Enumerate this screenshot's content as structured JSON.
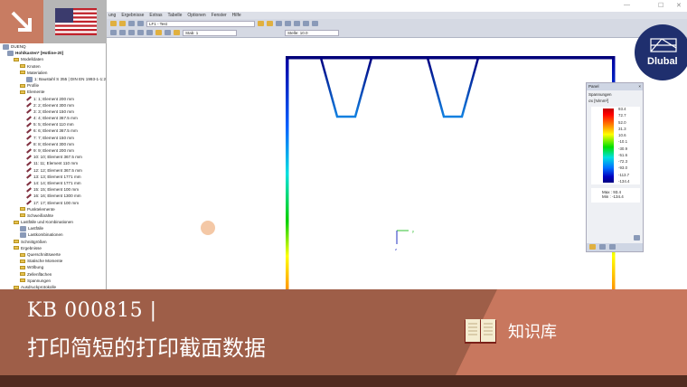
{
  "window": {
    "controls": [
      "—",
      "☐",
      "✕"
    ]
  },
  "menu": [
    "ung",
    "Ergebnisse",
    "Extras",
    "Tabelle",
    "Optionen",
    "Fenster",
    "Hilfe"
  ],
  "toolbar": {
    "loadcase": "LF1 - Test",
    "member": "Stab: 1",
    "location": "Stelle: 10.0"
  },
  "tree": {
    "root": "DUENQ",
    "project": "Hohlkasten* [Hotline-20]",
    "items": [
      {
        "label": "Modelldaten",
        "level": 1,
        "type": "folder"
      },
      {
        "label": "Knoten",
        "level": 2,
        "type": "folder"
      },
      {
        "label": "Materialien",
        "level": 2,
        "type": "folder"
      },
      {
        "label": "1: Baustahl S 355 | DIN EN 1993-1-1:2",
        "level": 3,
        "type": "material"
      },
      {
        "label": "Profile",
        "level": 2,
        "type": "folder"
      },
      {
        "label": "Elemente",
        "level": 2,
        "type": "folder"
      },
      {
        "label": "1: 1; Element 200 mm",
        "level": 3,
        "type": "element"
      },
      {
        "label": "2: 2; Element 300 mm",
        "level": 3,
        "type": "element"
      },
      {
        "label": "3: 3; Element 150 mm",
        "level": 3,
        "type": "element"
      },
      {
        "label": "4: 4; Element 367.5 mm",
        "level": 3,
        "type": "element"
      },
      {
        "label": "5: 5; Element 110 mm",
        "level": 3,
        "type": "element"
      },
      {
        "label": "6: 6; Element 367.5 mm",
        "level": 3,
        "type": "element"
      },
      {
        "label": "7: 7; Element 150 mm",
        "level": 3,
        "type": "element"
      },
      {
        "label": "8: 8; Element 300 mm",
        "level": 3,
        "type": "element"
      },
      {
        "label": "9: 9; Element 200 mm",
        "level": 3,
        "type": "element"
      },
      {
        "label": "10: 10; Element 367.5 mm",
        "level": 3,
        "type": "element"
      },
      {
        "label": "11: 11; Element 110 mm",
        "level": 3,
        "type": "element"
      },
      {
        "label": "12: 12; Element 367.5 mm",
        "level": 3,
        "type": "element"
      },
      {
        "label": "13: 13; Element 1771 mm",
        "level": 3,
        "type": "element"
      },
      {
        "label": "14: 14; Element 1771 mm",
        "level": 3,
        "type": "element"
      },
      {
        "label": "15: 15; Element 100 mm",
        "level": 3,
        "type": "element"
      },
      {
        "label": "16: 16; Element 1300 mm",
        "level": 3,
        "type": "element"
      },
      {
        "label": "17: 17; Element 100 mm",
        "level": 3,
        "type": "element"
      },
      {
        "label": "Punktelemente",
        "level": 2,
        "type": "folder"
      },
      {
        "label": "Schweißnähte",
        "level": 2,
        "type": "folder"
      },
      {
        "label": "Lastfälle und Kombinationen",
        "level": 1,
        "type": "folder"
      },
      {
        "label": "Lastfälle",
        "level": 2,
        "type": "load"
      },
      {
        "label": "Lastkombinationen",
        "level": 2,
        "type": "load"
      },
      {
        "label": "Schnittgrößen",
        "level": 1,
        "type": "folder"
      },
      {
        "label": "Ergebnisse",
        "level": 1,
        "type": "folder"
      },
      {
        "label": "Querschnittswerte",
        "level": 2,
        "type": "folder"
      },
      {
        "label": "Statische Momente",
        "level": 2,
        "type": "folder"
      },
      {
        "label": "Wölbung",
        "level": 2,
        "type": "folder"
      },
      {
        "label": "Zellenflächen",
        "level": 2,
        "type": "folder"
      },
      {
        "label": "Spannungen",
        "level": 2,
        "type": "folder"
      },
      {
        "label": "Ausdruckprotokolle",
        "level": 1,
        "type": "folder"
      }
    ]
  },
  "panel": {
    "title": "Panel",
    "close": "×",
    "heading": "Spannungen",
    "unit": "σx [N/mm²]",
    "levels": [
      "93.4",
      "72.7",
      "52.0",
      "31.3",
      "10.6",
      "-10.1",
      "-30.9",
      "-51.6",
      "-72.3",
      "-93.0",
      "-113.7",
      "-134.4"
    ],
    "max_label": "Max :",
    "max": "93.4",
    "min_label": "Min :",
    "min": "-134.4"
  },
  "axes": {
    "y": "y",
    "z": "z"
  },
  "banner": {
    "code": "KB 000815 |",
    "title": "打印简短的打印截面数据",
    "category": "知识库"
  },
  "logo": {
    "text": "Dlubal"
  },
  "colors": {
    "accent": "#c87c62",
    "banner": "#9e5e48",
    "banner_light": "#c8775e",
    "strip": "#512b20",
    "logo": "#1f2f6e"
  }
}
